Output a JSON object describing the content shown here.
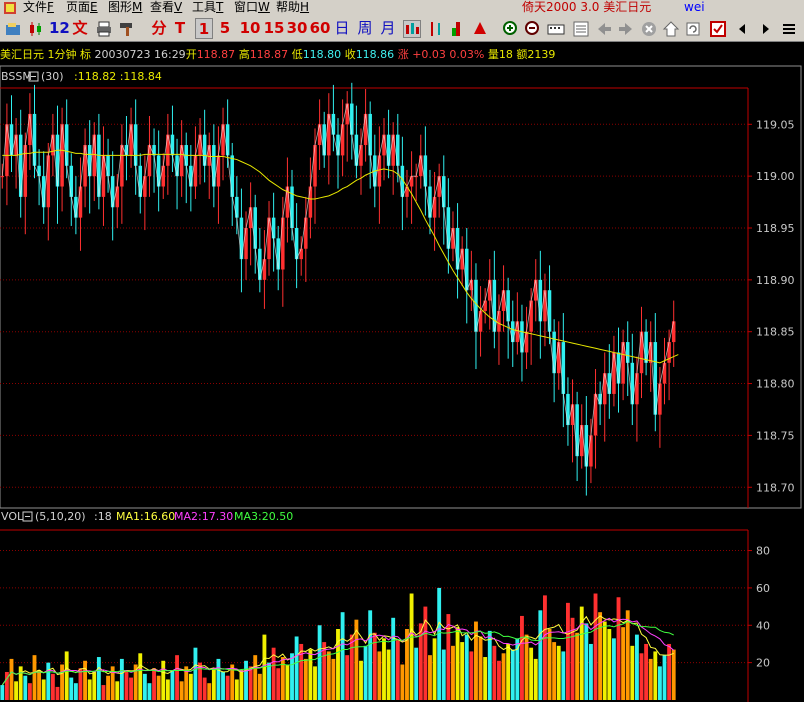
{
  "menu": [
    {
      "label": "文件",
      "key": "F"
    },
    {
      "label": "页面",
      "key": "E"
    },
    {
      "label": "图形",
      "key": "M"
    },
    {
      "label": "查看",
      "key": "V"
    },
    {
      "label": "工具",
      "key": "T"
    },
    {
      "label": "窗口",
      "key": "W"
    },
    {
      "label": "帮助",
      "key": "H"
    }
  ],
  "app": {
    "title": "倚天2000 3.0",
    "instrument": "美汇日元",
    "user": "wei"
  },
  "toolbar": {
    "period_12": "12",
    "text_btn": "文",
    "minute_btn": "分",
    "tick_btn": "T",
    "p1": "1",
    "p5": "5",
    "p10": "10",
    "p15": "15",
    "p30": "30",
    "p60": "60",
    "day": "日",
    "week": "周",
    "month": "月"
  },
  "infobar": {
    "symbol": "美汇日元",
    "period": "1分钟",
    "mark": "标",
    "datetime": "20030723 16:29",
    "open_label": "开",
    "open": "118.87",
    "high_label": "高",
    "high": "118.87",
    "low_label": "低",
    "low": "118.80",
    "close_label": "收",
    "close": "118.86",
    "change_label": "涨",
    "change": "+0.03",
    "change_pct": "0.03%",
    "volume_label": "量",
    "volume": "18",
    "amount_label": "额",
    "amount": "2139"
  },
  "colors": {
    "up": "#ff3030",
    "down": "#30f0f0",
    "ma": "#e8e800",
    "grid": "#8b0000",
    "axis": "#c00000",
    "axis_text": "#c8c8c8",
    "border": "#808080",
    "vol_yellow": "#f0f000",
    "vol_orange": "#ff9800",
    "vol_red": "#ff3030",
    "vol_cyan": "#30f0f0",
    "ma1": "#ffff40",
    "ma2": "#ff40ff",
    "ma3": "#40ff40"
  },
  "chart_data": [
    {
      "type": "candlestick",
      "indicator": "BSSM",
      "indicator_param": "(30)",
      "indicator_values": "118.82 :118.84",
      "ylim": [
        118.68,
        119.085
      ],
      "y_ticks": [
        119.05,
        119.0,
        118.95,
        118.9,
        118.85,
        118.8,
        118.75,
        118.7
      ],
      "y_tick_labels": [
        "119.05",
        "119.00",
        "118.95",
        "118.90",
        "118.85",
        "118.80",
        "118.75",
        "118.70"
      ],
      "close": [
        119.0,
        119.05,
        119.02,
        119.04,
        118.98,
        119.03,
        119.06,
        119.01,
        119.0,
        118.97,
        119.02,
        119.04,
        118.99,
        119.05,
        119.01,
        118.98,
        118.96,
        118.99,
        119.03,
        119.0,
        119.04,
        118.98,
        119.02,
        119.0,
        118.97,
        118.99,
        119.03,
        119.02,
        119.05,
        119.01,
        118.98,
        119.0,
        119.03,
        119.02,
        118.99,
        119.01,
        119.04,
        119.02,
        119.0,
        119.03,
        119.01,
        118.99,
        119.02,
        119.04,
        119.01,
        119.03,
        118.99,
        119.02,
        119.05,
        119.02,
        118.98,
        118.96,
        118.92,
        118.95,
        118.97,
        118.93,
        118.9,
        118.92,
        118.96,
        118.94,
        118.91,
        118.96,
        118.99,
        118.95,
        118.92,
        118.93,
        118.96,
        118.99,
        119.03,
        119.05,
        119.02,
        119.06,
        119.04,
        119.02,
        119.05,
        119.07,
        119.04,
        119.01,
        119.03,
        119.06,
        119.02,
        118.99,
        119.02,
        119.04,
        119.01,
        119.04,
        119.01,
        118.98,
        118.99,
        119.0,
        119.0,
        119.02,
        118.99,
        118.96,
        118.98,
        119.0,
        118.97,
        118.93,
        118.95,
        118.91,
        118.93,
        118.89,
        118.9,
        118.85,
        118.87,
        118.88,
        118.9,
        118.85,
        118.87,
        118.89,
        118.86,
        118.84,
        118.86,
        118.83,
        118.85,
        118.88,
        118.9,
        118.86,
        118.89,
        118.85,
        118.81,
        118.84,
        118.79,
        118.76,
        118.78,
        118.73,
        118.76,
        118.72,
        118.75,
        118.79,
        118.78,
        118.81,
        118.79,
        118.83,
        118.8,
        118.84,
        118.82,
        118.78,
        118.81,
        118.85,
        118.82,
        118.84,
        118.77,
        118.8,
        118.82,
        118.84,
        118.86
      ],
      "moving_average": [
        119.02,
        119.02,
        119.02,
        119.02,
        119.021,
        119.022,
        119.022,
        119.023,
        119.023,
        119.023,
        119.023,
        119.024,
        119.025,
        119.025,
        119.024,
        119.023,
        119.022,
        119.022,
        119.021,
        119.021,
        119.021,
        119.02,
        119.02,
        119.02,
        119.02,
        119.02,
        119.02,
        119.02,
        119.02,
        119.02,
        119.02,
        119.021,
        119.021,
        119.021,
        119.021,
        119.021,
        119.021,
        119.021,
        119.021,
        119.021,
        119.02,
        119.02,
        119.02,
        119.02,
        119.02,
        119.019,
        119.019,
        119.019,
        119.019,
        119.018,
        119.017,
        119.016,
        119.014,
        119.012,
        119.01,
        119.007,
        119.004,
        119.0,
        118.996,
        118.993,
        118.99,
        118.987,
        118.985,
        118.983,
        118.981,
        118.98,
        118.979,
        118.978,
        118.978,
        118.979,
        118.98,
        118.981,
        118.983,
        118.985,
        118.988,
        118.99,
        118.993,
        118.996,
        118.998,
        119.001,
        119.003,
        119.005,
        119.006,
        119.007,
        119.006,
        119.005,
        119.002,
        118.997,
        118.99,
        118.983,
        118.975,
        118.967,
        118.958,
        118.95,
        118.942,
        118.933,
        118.925,
        118.917,
        118.909,
        118.902,
        118.895,
        118.888,
        118.882,
        118.877,
        118.872,
        118.868,
        118.864,
        118.861,
        118.858,
        118.856,
        118.854,
        118.852,
        118.851,
        118.85,
        118.849,
        118.848,
        118.847,
        118.846,
        118.845,
        118.844,
        118.843,
        118.842,
        118.841,
        118.84,
        118.839,
        118.838,
        118.837,
        118.836,
        118.835,
        118.834,
        118.833,
        118.832,
        118.831,
        118.83,
        118.829,
        118.828,
        118.827,
        118.826,
        118.825,
        118.824,
        118.823,
        118.822,
        118.821,
        118.82,
        118.822,
        118.824,
        118.826,
        118.828
      ]
    },
    {
      "type": "bar",
      "indicator": "VOL",
      "indicator_param": "(5,10,20)",
      "current_volume": ":18",
      "ma_labels": [
        "MA1",
        "MA2",
        "MA3"
      ],
      "ma_values": [
        "16.60",
        "17.30",
        "20.50"
      ],
      "ylim": [
        0,
        91
      ],
      "y_ticks": [
        80,
        60,
        40,
        20
      ],
      "y_tick_labels": [
        "80",
        "60",
        "40",
        "20"
      ],
      "values": [
        8,
        15,
        22,
        10,
        18,
        13,
        9,
        24,
        16,
        11,
        20,
        14,
        7,
        19,
        26,
        12,
        9,
        17,
        21,
        11,
        15,
        23,
        8,
        13,
        18,
        10,
        22,
        16,
        12,
        19,
        25,
        14,
        9,
        17,
        13,
        21,
        11,
        16,
        24,
        10,
        18,
        14,
        28,
        20,
        12,
        9,
        17,
        22,
        15,
        13,
        19,
        11,
        16,
        21,
        18,
        24,
        14,
        35,
        20,
        28,
        17,
        23,
        19,
        25,
        34,
        30,
        22,
        27,
        18,
        40,
        31,
        26,
        22,
        38,
        47,
        24,
        35,
        43,
        21,
        29,
        48,
        36,
        26,
        33,
        27,
        44,
        32,
        19,
        38,
        57,
        28,
        41,
        50,
        24,
        33,
        60,
        27,
        46,
        29,
        39,
        31,
        35,
        26,
        42,
        34,
        23,
        37,
        29,
        21,
        25,
        30,
        27,
        33,
        45,
        35,
        28,
        22,
        48,
        56,
        38,
        31,
        29,
        26,
        52,
        44,
        36,
        50,
        41,
        30,
        57,
        47,
        42,
        38,
        33,
        55,
        39,
        48,
        29,
        35,
        25,
        30,
        22,
        26,
        18,
        24,
        30,
        27
      ]
    }
  ]
}
